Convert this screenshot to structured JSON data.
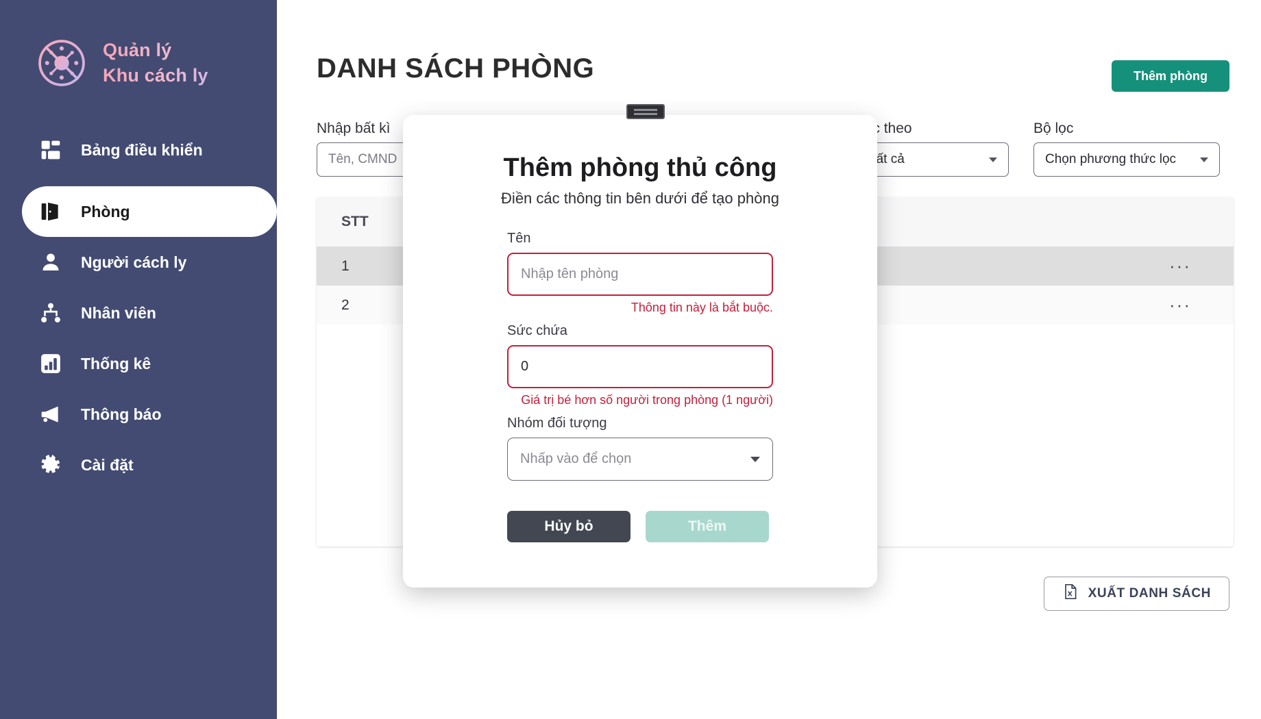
{
  "brand": {
    "logo_icon": "virus-blocked-icon",
    "line1": "Quản lý",
    "line2": "Khu cách ly"
  },
  "sidebar": {
    "items": [
      {
        "label": "Bảng điều khiển",
        "icon": "dashboard-grid-icon",
        "active": false
      },
      {
        "label": "Phòng",
        "icon": "door-icon",
        "active": true
      },
      {
        "label": "Người cách ly",
        "icon": "person-icon",
        "active": false
      },
      {
        "label": "Nhân viên",
        "icon": "org-tree-icon",
        "active": false
      },
      {
        "label": "Thống kê",
        "icon": "bar-chart-icon",
        "active": false
      },
      {
        "label": "Thông báo",
        "icon": "megaphone-icon",
        "active": false
      },
      {
        "label": "Cài đặt",
        "icon": "gear-icon",
        "active": false
      }
    ]
  },
  "header": {
    "title": "DANH SÁCH PHÒNG",
    "add_room_label": "Thêm phòng"
  },
  "filters": {
    "search": {
      "label": "Nhập bất kì",
      "placeholder": "Tên, CMND"
    },
    "filter_by": {
      "label": "Lọc theo",
      "value": "Tất cả",
      "icon": "funnel-icon"
    },
    "filter_set": {
      "label": "Bộ lọc",
      "value": "Chọn phương thức lọc"
    }
  },
  "table": {
    "columns": [
      "STT"
    ],
    "rows": [
      {
        "stt": "1",
        "menu": "···"
      },
      {
        "stt": "2",
        "menu": "···"
      }
    ]
  },
  "footer": {
    "export_label": "XUẤT DANH SÁCH",
    "export_icon": "excel-file-icon"
  },
  "modal": {
    "drag_handle_icon": "drag-handle-icon",
    "title": "Thêm phòng thủ công",
    "subtitle": "Điền các thông tin bên dưới để tạo phòng",
    "fields": {
      "name": {
        "label": "Tên",
        "value": "",
        "placeholder": "Nhập tên phòng",
        "error": "Thông tin này là bắt buộc."
      },
      "capacity": {
        "label": "Sức chứa",
        "value": "0",
        "placeholder": "",
        "error": "Giá trị bé hơn số người trong phòng (1 người)"
      },
      "group": {
        "label": "Nhóm đối tượng",
        "value": "Nhấp vào để chọn",
        "icon": "chevron-down-icon"
      }
    },
    "cancel_label": "Hủy bỏ",
    "submit_label": "Thêm"
  },
  "colors": {
    "sidebar_bg": "#434b72",
    "brand_pink": "#f2acc4",
    "accent_green": "#15907b",
    "error_red": "#c2203b",
    "submit_disabled": "#a8d8cd",
    "cancel_dark": "#424751",
    "row_highlight": "#dedede"
  }
}
